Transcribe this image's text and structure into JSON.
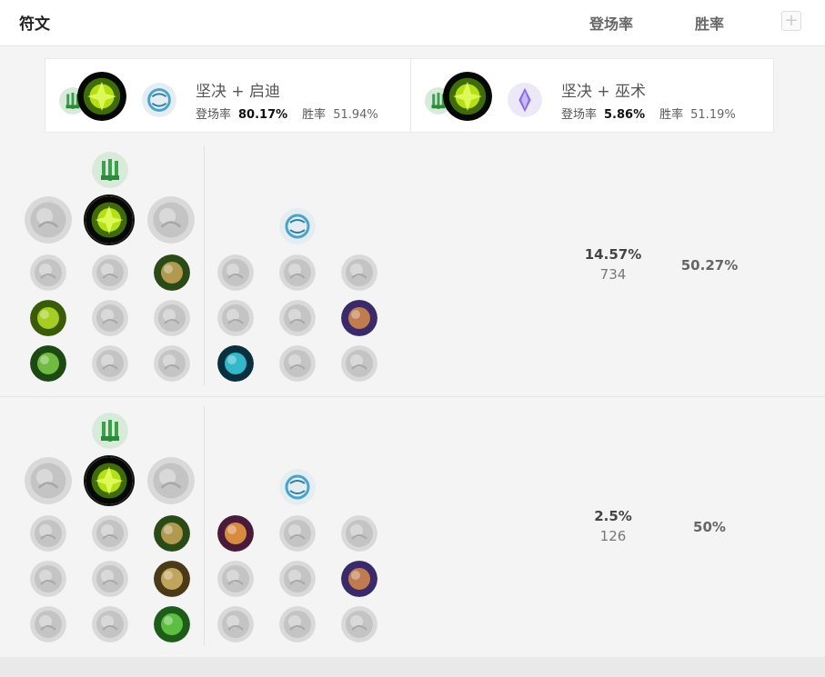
{
  "header": {
    "title": "符文",
    "col_pickrate": "登场率",
    "col_winrate": "胜率",
    "add_label": "+"
  },
  "summary": [
    {
      "name": "坚决 + 启迪",
      "pick_label": "登场率",
      "pick_value": "80.17%",
      "win_label": "胜率",
      "win_value": "51.94%",
      "primary_icon": "resolve-tree-icon",
      "keystone_icon": "aftershock-icon",
      "secondary_icon": "inspiration-tree-icon"
    },
    {
      "name": "坚决 + 巫术",
      "pick_label": "登场率",
      "pick_value": "5.86%",
      "win_label": "胜率",
      "win_value": "51.19%",
      "primary_icon": "resolve-tree-icon",
      "keystone_icon": "aftershock-icon",
      "secondary_icon": "sorcery-tree-icon"
    }
  ],
  "builds": [
    {
      "pick_rate": "14.57%",
      "count": "734",
      "win_rate": "50.27%",
      "primary_tree_icon": "resolve-tree-icon",
      "keystones": [
        {
          "icon": "grasp-icon",
          "active": false
        },
        {
          "icon": "aftershock-icon",
          "active": true
        },
        {
          "icon": "guardian-icon",
          "active": false
        }
      ],
      "primary_rows": [
        [
          {
            "icon": "demolish-icon",
            "active": false
          },
          {
            "icon": "font-of-life-icon",
            "active": false
          },
          {
            "icon": "shield-bash-icon",
            "active": true
          }
        ],
        [
          {
            "icon": "conditioning-icon",
            "active": true
          },
          {
            "icon": "second-wind-icon",
            "active": false
          },
          {
            "icon": "bone-plating-icon",
            "active": false
          }
        ],
        [
          {
            "icon": "overgrowth-icon",
            "active": true
          },
          {
            "icon": "revitalize-icon",
            "active": false
          },
          {
            "icon": "unflinching-icon",
            "active": false
          }
        ]
      ],
      "secondary_tree_icon": "inspiration-tree-icon",
      "secondary_rows": [
        [
          {
            "icon": "hextech-flashtraption-icon",
            "active": false
          },
          {
            "icon": "magical-footwear-icon",
            "active": false
          },
          {
            "icon": "cash-back-icon",
            "active": false
          }
        ],
        [
          {
            "icon": "triple-tonic-icon",
            "active": false
          },
          {
            "icon": "time-warp-tonic-icon",
            "active": false
          },
          {
            "icon": "biscuit-delivery-icon",
            "active": true
          }
        ],
        [
          {
            "icon": "cosmic-insight-icon",
            "active": true
          },
          {
            "icon": "approach-velocity-icon",
            "active": false
          },
          {
            "icon": "jack-of-all-trades-icon",
            "active": false
          }
        ]
      ]
    },
    {
      "pick_rate": "2.5%",
      "count": "126",
      "win_rate": "50%",
      "primary_tree_icon": "resolve-tree-icon",
      "keystones": [
        {
          "icon": "grasp-icon",
          "active": false
        },
        {
          "icon": "aftershock-icon",
          "active": true
        },
        {
          "icon": "guardian-icon",
          "active": false
        }
      ],
      "primary_rows": [
        [
          {
            "icon": "demolish-icon",
            "active": false
          },
          {
            "icon": "font-of-life-icon",
            "active": false
          },
          {
            "icon": "shield-bash-icon",
            "active": true
          }
        ],
        [
          {
            "icon": "conditioning-icon",
            "active": false
          },
          {
            "icon": "second-wind-icon",
            "active": false
          },
          {
            "icon": "bone-plating-icon",
            "active": true
          }
        ],
        [
          {
            "icon": "overgrowth-icon",
            "active": false
          },
          {
            "icon": "revitalize-icon",
            "active": false
          },
          {
            "icon": "unflinching-icon",
            "active": true
          }
        ]
      ],
      "secondary_tree_icon": "inspiration-tree-icon",
      "secondary_rows": [
        [
          {
            "icon": "hextech-flashtraption-icon",
            "active": true
          },
          {
            "icon": "magical-footwear-icon",
            "active": false
          },
          {
            "icon": "cash-back-icon",
            "active": false
          }
        ],
        [
          {
            "icon": "triple-tonic-icon",
            "active": false
          },
          {
            "icon": "time-warp-tonic-icon",
            "active": false
          },
          {
            "icon": "biscuit-delivery-icon",
            "active": true
          }
        ],
        [
          {
            "icon": "cosmic-insight-icon",
            "active": false
          },
          {
            "icon": "approach-velocity-icon",
            "active": false
          },
          {
            "icon": "jack-of-all-trades-icon",
            "active": false
          }
        ]
      ]
    }
  ],
  "colors": {
    "resolve": "#3aa04a",
    "aftershock": "#b6e016",
    "inspiration": "#4aa3c9",
    "sorcery": "#8a6ee8",
    "inactive": "#bdbdbd"
  }
}
